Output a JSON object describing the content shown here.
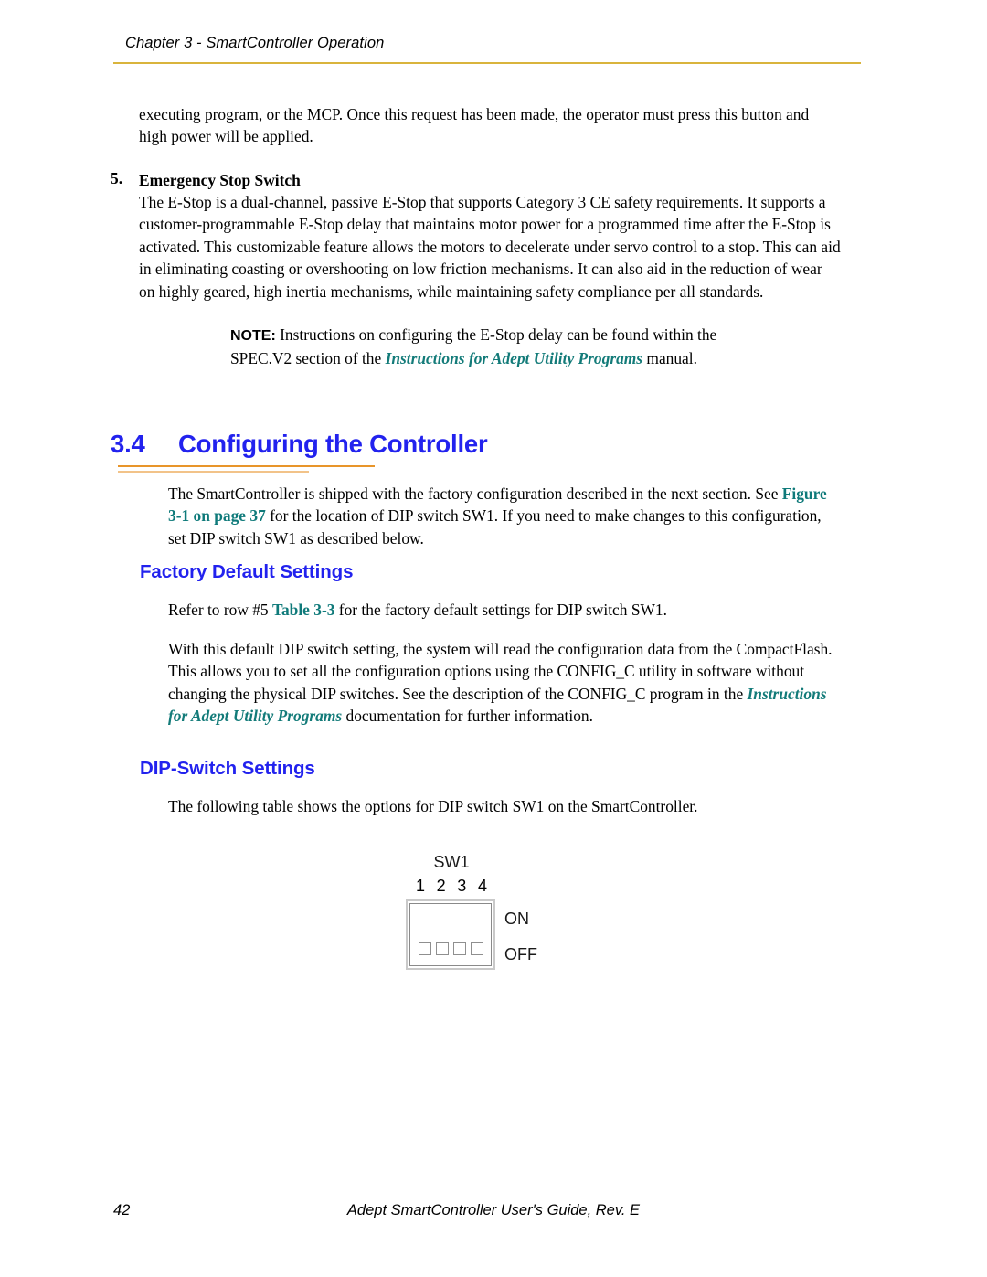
{
  "header": {
    "chapter_title": "Chapter 3 - SmartController Operation",
    "rule_color": "#d9b43c"
  },
  "colors": {
    "heading_blue": "#2222ee",
    "xref_teal": "#0f7a7a",
    "rule_orange": "#e8952a",
    "rule_orange_light": "#f2c389",
    "header_gold": "#d9b43c"
  },
  "intro_paragraph": "executing program, or the MCP. Once this request has been made, the operator must press this button and high power will be applied.",
  "list_item": {
    "number": "5.",
    "title": "Emergency Stop Switch",
    "body": "The E-Stop is a dual-channel, passive E-Stop that supports Category 3 CE safety requirements. It supports a customer-programmable E-Stop delay that maintains motor power for a programmed time after the E-Stop is activated. This customizable feature allows the motors to decelerate under servo control to a stop. This can aid in eliminating coasting or overshooting on low friction mechanisms. It can also aid in the reduction of wear on highly geared, high inertia mechanisms, while maintaining safety compliance per all standards."
  },
  "note": {
    "label": "NOTE:",
    "text_before": " Instructions on configuring the E-Stop delay can be found within the SPEC.V2 section of the ",
    "reference": "Instructions for Adept Utility Programs",
    "text_after": " manual."
  },
  "section": {
    "number": "3.4",
    "title": "Configuring the Controller"
  },
  "configuring_paragraph": {
    "text_before": "The SmartController is shipped with the factory configuration described in the next section. See ",
    "reference": "Figure 3-1 on page 37",
    "text_after": " for the location of DIP switch SW1. If you need to make changes to this configuration, set DIP switch SW1 as described below."
  },
  "factory_defaults": {
    "heading": "Factory Default Settings",
    "refer_before": "Refer to row #5 ",
    "refer_reference": "Table 3-3",
    "refer_after": " for the factory default settings for DIP switch SW1.",
    "flash_before": "With this default DIP switch setting, the system will read the configuration data from the CompactFlash. This allows you to set all the configuration options using the CONFIG_C utility in software without changing the physical DIP switches. See the description of the CONFIG_C program in the ",
    "flash_reference": "Instructions for Adept Utility Programs",
    "flash_after": " documentation for further information."
  },
  "dip_switch_settings": {
    "heading": "DIP-Switch Settings",
    "intro": "The following table shows the options for DIP switch SW1 on the SmartController.",
    "figure": {
      "switch_name": "SW1",
      "switch_numbers": [
        "1",
        "2",
        "3",
        "4"
      ],
      "on_label": "ON",
      "off_label": "OFF",
      "positions": [
        "OFF",
        "OFF",
        "OFF",
        "OFF"
      ]
    }
  },
  "footer": {
    "page_number": "42",
    "document_title": "Adept SmartController User's Guide, Rev. E"
  }
}
